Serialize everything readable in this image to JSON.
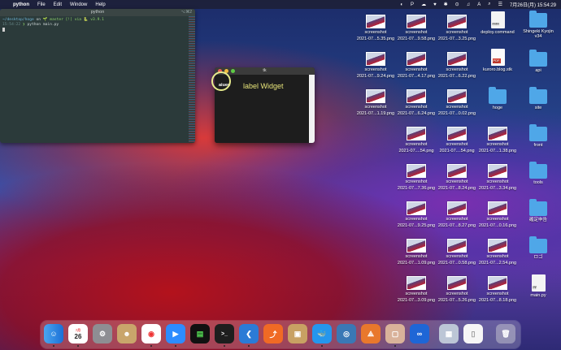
{
  "menubar": {
    "apple": "",
    "app": "python",
    "menus": [
      "File",
      "Edit",
      "Window",
      "Help"
    ],
    "status": [
      "◐",
      "P",
      "☁",
      "♥",
      "✱",
      "⊙",
      "♫",
      "A",
      "⌕",
      "☰"
    ],
    "clock": "7月26日(月) 15:54:29"
  },
  "terminal": {
    "title": "python",
    "shortcut": "⌥⌘2",
    "line1_path": "~/desktop/hoge",
    "line1_on": " on ",
    "line1_branch": "🌱 master [!] via 🐍 v3.9.1",
    "line2_time": "15:54:22",
    "line2_prompt": " ❯ ",
    "line2_cmd": "python main.py"
  },
  "tk": {
    "title": "tk",
    "button_label": "aiueo",
    "widget_label": "label Widget"
  },
  "desktop": {
    "thumbs": [
      {
        "l1": "screenshot",
        "l2": "2021-07...5.35.png"
      },
      {
        "l1": "screenshot",
        "l2": "2021-07...9.58.png"
      },
      {
        "l1": "screenshot",
        "l2": "2021-07...3.25.png"
      },
      {
        "l1": "screenshot",
        "l2": "2021-07...9.24.png"
      },
      {
        "l1": "screenshot",
        "l2": "2021-07...4.17.png"
      },
      {
        "l1": "screenshot",
        "l2": "2021-07...6.22.png"
      },
      {
        "l1": "screenshot",
        "l2": "2021-07...1.19.png"
      },
      {
        "l1": "screenshot",
        "l2": "2021-07...6.24.png"
      },
      {
        "l1": "screenshot",
        "l2": "2021-07...0.02.png"
      },
      {
        "l1": "screenshot",
        "l2": "2021-07....54.png"
      },
      {
        "l1": "screenshot",
        "l2": "2021-07....54.png"
      },
      {
        "l1": "screenshot",
        "l2": "2021-07...1.38.png"
      },
      {
        "l1": "screenshot",
        "l2": "2021-07...7.36.png"
      },
      {
        "l1": "screenshot",
        "l2": "2021-07...8.24.png"
      },
      {
        "l1": "screenshot",
        "l2": "2021-07...3.34.png"
      },
      {
        "l1": "screenshot",
        "l2": "2021-07...9.25.png"
      },
      {
        "l1": "screenshot",
        "l2": "2021-07...8.27.png"
      },
      {
        "l1": "screenshot",
        "l2": "2021-07...0.16.png"
      },
      {
        "l1": "screenshot",
        "l2": "2021-07...1.09.png"
      },
      {
        "l1": "screenshot",
        "l2": "2021-07...0.58.png"
      },
      {
        "l1": "screenshot",
        "l2": "2021-07...2.54.png"
      },
      {
        "l1": "screenshot",
        "l2": "2021-07...3.09.png"
      },
      {
        "l1": "screenshot",
        "l2": "2021-07...5.26.png"
      },
      {
        "l1": "screenshot",
        "l2": "2021-07...8.18.png"
      }
    ],
    "files": {
      "deploy": "deploy.command",
      "kuroro": "kuroro.blog.stk",
      "hoge": "hoge",
      "main": "main.py",
      "shingeki": "Shingeki Kyojin v34",
      "api": "api",
      "site": "site",
      "front": "front",
      "tools": "tools",
      "kakutei": "確定申告",
      "logo": "ロゴ"
    }
  },
  "dock": {
    "calendar_day": "26",
    "calendar_month": "7月",
    "terminal_glyph": ">_"
  }
}
